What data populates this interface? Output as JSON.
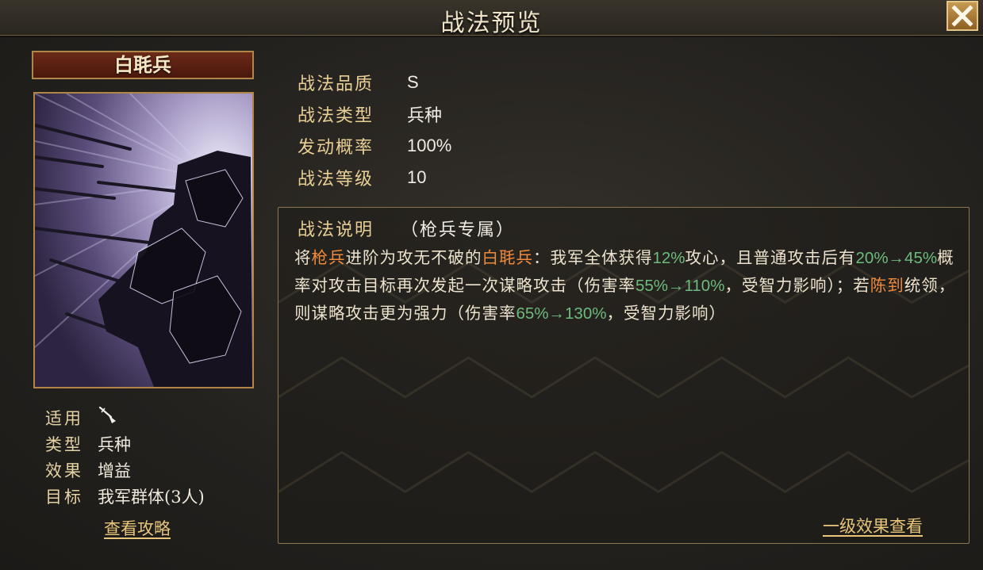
{
  "window": {
    "title": "战法预览"
  },
  "card": {
    "name": "白毦兵",
    "meta": [
      {
        "key": "适用",
        "value": "",
        "icon": "spear-icon"
      },
      {
        "key": "类型",
        "value": "兵种"
      },
      {
        "key": "效果",
        "value": "增益"
      },
      {
        "key": "目标",
        "value": "我军群体(3人)"
      }
    ],
    "guide_link": "查看攻略"
  },
  "info": [
    {
      "key": "战法品质",
      "value": "S"
    },
    {
      "key": "战法类型",
      "value": "兵种"
    },
    {
      "key": "发动概率",
      "value": "100%"
    },
    {
      "key": "战法等级",
      "value": "10"
    }
  ],
  "description": {
    "heading": "战法说明",
    "subheading": "（枪兵专属）",
    "segments": [
      {
        "t": "将",
        "c": ""
      },
      {
        "t": "枪兵",
        "c": "orange"
      },
      {
        "t": "进阶为攻无不破的",
        "c": ""
      },
      {
        "t": "白毦兵",
        "c": "orange"
      },
      {
        "t": "：我军全体获得",
        "c": ""
      },
      {
        "t": "12%",
        "c": "green"
      },
      {
        "t": "攻心，且普通攻击后有",
        "c": ""
      },
      {
        "t": "20%→45%",
        "c": "green"
      },
      {
        "t": "概率对攻击目标再次发起一次谋略攻击（伤害率",
        "c": ""
      },
      {
        "t": "55%→110%",
        "c": "green"
      },
      {
        "t": "，受智力影响）；若",
        "c": ""
      },
      {
        "t": "陈到",
        "c": "orange"
      },
      {
        "t": "统领，则谋略攻击更为强力（伤害率",
        "c": ""
      },
      {
        "t": "65%→130%",
        "c": "green"
      },
      {
        "t": "，受智力影响）",
        "c": ""
      }
    ],
    "level_link": "一级效果查看"
  },
  "colors": {
    "accent_gold": "#e8c57a",
    "highlight_orange": "#ef8a3c",
    "highlight_green": "#6dbb7e"
  }
}
